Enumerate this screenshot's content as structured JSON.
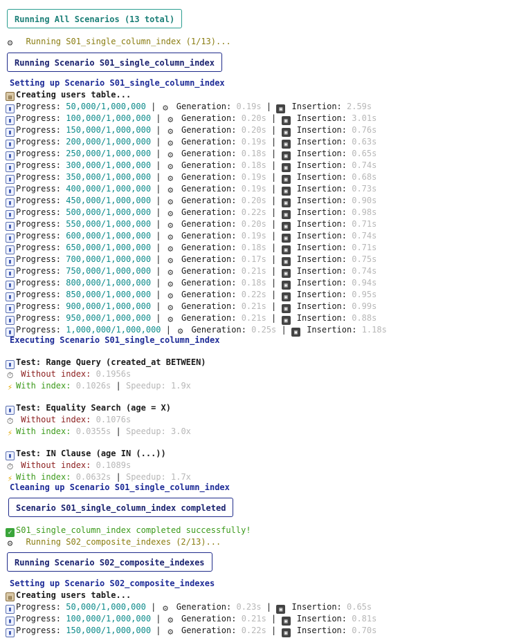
{
  "header": {
    "banner": "Running All Scenarios (13 total)"
  },
  "s01": {
    "running": "Running S01_single_column_index (1/13)...",
    "scenario_box": "Running Scenario S01_single_column_index",
    "setup": "Setting up Scenario S01_single_column_index",
    "creating": "Creating users table...",
    "progress": [
      {
        "count": "50,000/1,000,000",
        "gen": "0.19s",
        "ins": "2.59s"
      },
      {
        "count": "100,000/1,000,000",
        "gen": "0.20s",
        "ins": "3.01s"
      },
      {
        "count": "150,000/1,000,000",
        "gen": "0.20s",
        "ins": "0.76s"
      },
      {
        "count": "200,000/1,000,000",
        "gen": "0.19s",
        "ins": "0.63s"
      },
      {
        "count": "250,000/1,000,000",
        "gen": "0.18s",
        "ins": "0.65s"
      },
      {
        "count": "300,000/1,000,000",
        "gen": "0.18s",
        "ins": "0.74s"
      },
      {
        "count": "350,000/1,000,000",
        "gen": "0.19s",
        "ins": "0.68s"
      },
      {
        "count": "400,000/1,000,000",
        "gen": "0.19s",
        "ins": "0.73s"
      },
      {
        "count": "450,000/1,000,000",
        "gen": "0.20s",
        "ins": "0.90s"
      },
      {
        "count": "500,000/1,000,000",
        "gen": "0.22s",
        "ins": "0.98s"
      },
      {
        "count": "550,000/1,000,000",
        "gen": "0.20s",
        "ins": "0.71s"
      },
      {
        "count": "600,000/1,000,000",
        "gen": "0.19s",
        "ins": "0.74s"
      },
      {
        "count": "650,000/1,000,000",
        "gen": "0.18s",
        "ins": "0.71s"
      },
      {
        "count": "700,000/1,000,000",
        "gen": "0.17s",
        "ins": "0.75s"
      },
      {
        "count": "750,000/1,000,000",
        "gen": "0.21s",
        "ins": "0.74s"
      },
      {
        "count": "800,000/1,000,000",
        "gen": "0.18s",
        "ins": "0.94s"
      },
      {
        "count": "850,000/1,000,000",
        "gen": "0.22s",
        "ins": "0.95s"
      },
      {
        "count": "900,000/1,000,000",
        "gen": "0.21s",
        "ins": "0.99s"
      },
      {
        "count": "950,000/1,000,000",
        "gen": "0.21s",
        "ins": "0.88s"
      },
      {
        "count": "1,000,000/1,000,000",
        "gen": "0.25s",
        "ins": "1.18s"
      }
    ],
    "executing": "Executing Scenario S01_single_column_index",
    "tests": [
      {
        "name": "Test: Range Query (created_at BETWEEN)",
        "without": "0.1956s",
        "with": "0.1026s",
        "speedup": "Speedup: 1.9x"
      },
      {
        "name": "Test: Equality Search (age = X)",
        "without": "0.1076s",
        "with": "0.0355s",
        "speedup": "Speedup: 3.0x"
      },
      {
        "name": "Test: IN Clause (age IN (...))",
        "without": "0.1089s",
        "with": "0.0632s",
        "speedup": "Speedup: 1.7x"
      }
    ],
    "cleaning": "Cleaning up Scenario S01_single_column_index",
    "completed_box": "Scenario S01_single_column_index completed",
    "success": "S01_single_column_index completed successfully!"
  },
  "s02": {
    "running": "Running S02_composite_indexes (2/13)...",
    "scenario_box": "Running Scenario S02_composite_indexes",
    "setup": "Setting up Scenario S02_composite_indexes",
    "creating": "Creating users table...",
    "progress": [
      {
        "count": "50,000/1,000,000",
        "gen": "0.23s",
        "ins": "0.65s"
      },
      {
        "count": "100,000/1,000,000",
        "gen": "0.21s",
        "ins": "0.81s"
      },
      {
        "count": "150,000/1,000,000",
        "gen": "0.22s",
        "ins": "0.70s"
      }
    ]
  },
  "labels": {
    "progress": "Progress: ",
    "generation": "Generation: ",
    "insertion": "Insertion: ",
    "without_index": "Without index: ",
    "with_index": "With index: ",
    "sep": " | "
  },
  "colors": {
    "teal_box": "#2a9d8f",
    "navy_box": "#1e2a8a",
    "olive": "#8a7d12",
    "teal": "#0b8a8a",
    "navy": "#1c2a96",
    "gray": "#b7b7b7",
    "red": "#8b1d1d",
    "green": "#3c9a1b"
  },
  "icons": {
    "gear": "gear-icon",
    "chart": "bar-chart-icon",
    "disk": "floppy-disk-icon",
    "clipboard": "clipboard-icon",
    "check": "check-icon",
    "timer": "stopwatch-icon",
    "bolt": "lightning-icon"
  }
}
